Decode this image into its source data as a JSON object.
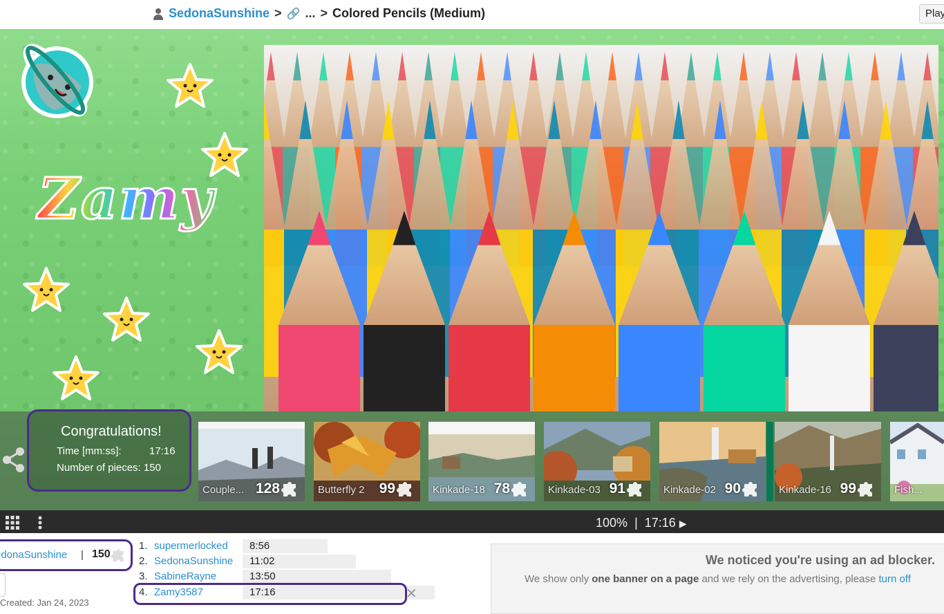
{
  "breadcrumb": {
    "user": "SedonaSunshine",
    "separator": ">",
    "middle": "...",
    "title": "Colored Pencils (Medium)"
  },
  "play_button": "Play",
  "brand_text": "Zamy",
  "congrats": {
    "heading": "Congratulations!",
    "time_label": "Time [mm:ss]:",
    "time_value": "17:16",
    "pieces_label": "Number of pieces: 150"
  },
  "thumbnails": [
    {
      "caption": "Couple...",
      "count": "128"
    },
    {
      "caption": "Butterfly 2",
      "count": "99"
    },
    {
      "caption": "Kinkade-18",
      "count": "78"
    },
    {
      "caption": "Kinkade-03",
      "count": "91"
    },
    {
      "caption": "Kinkade-02",
      "count": "90"
    },
    {
      "caption": "Kinkade-16",
      "count": "99"
    },
    {
      "caption": "Fish...",
      "count": ""
    }
  ],
  "toolbar": {
    "zoom": "100%",
    "divider": "|",
    "time": "17:16",
    "play_glyph": "▶"
  },
  "my_score": {
    "name": "edonaSunshine",
    "divider": "|",
    "pieces": "150"
  },
  "created_text": "Created: Jan 24, 2023",
  "leaderboard": [
    {
      "rank": "1.",
      "name": "supermerlocked",
      "time": "8:56",
      "bar": 0.44
    },
    {
      "rank": "2.",
      "name": "SedonaSunshine",
      "time": "11:02",
      "bar": 0.55
    },
    {
      "rank": "3.",
      "name": "SabineRayne",
      "time": "13:50",
      "bar": 0.69
    },
    {
      "rank": "4.",
      "name": "Zamy3587",
      "time": "17:16",
      "bar": 0.86
    }
  ],
  "adblock": {
    "heading": "We noticed you're using an ad blocker.",
    "text_a": "We show only ",
    "text_b": "one banner on a page",
    "text_c": " and we rely on the advertising, please ",
    "link": "turn off"
  }
}
